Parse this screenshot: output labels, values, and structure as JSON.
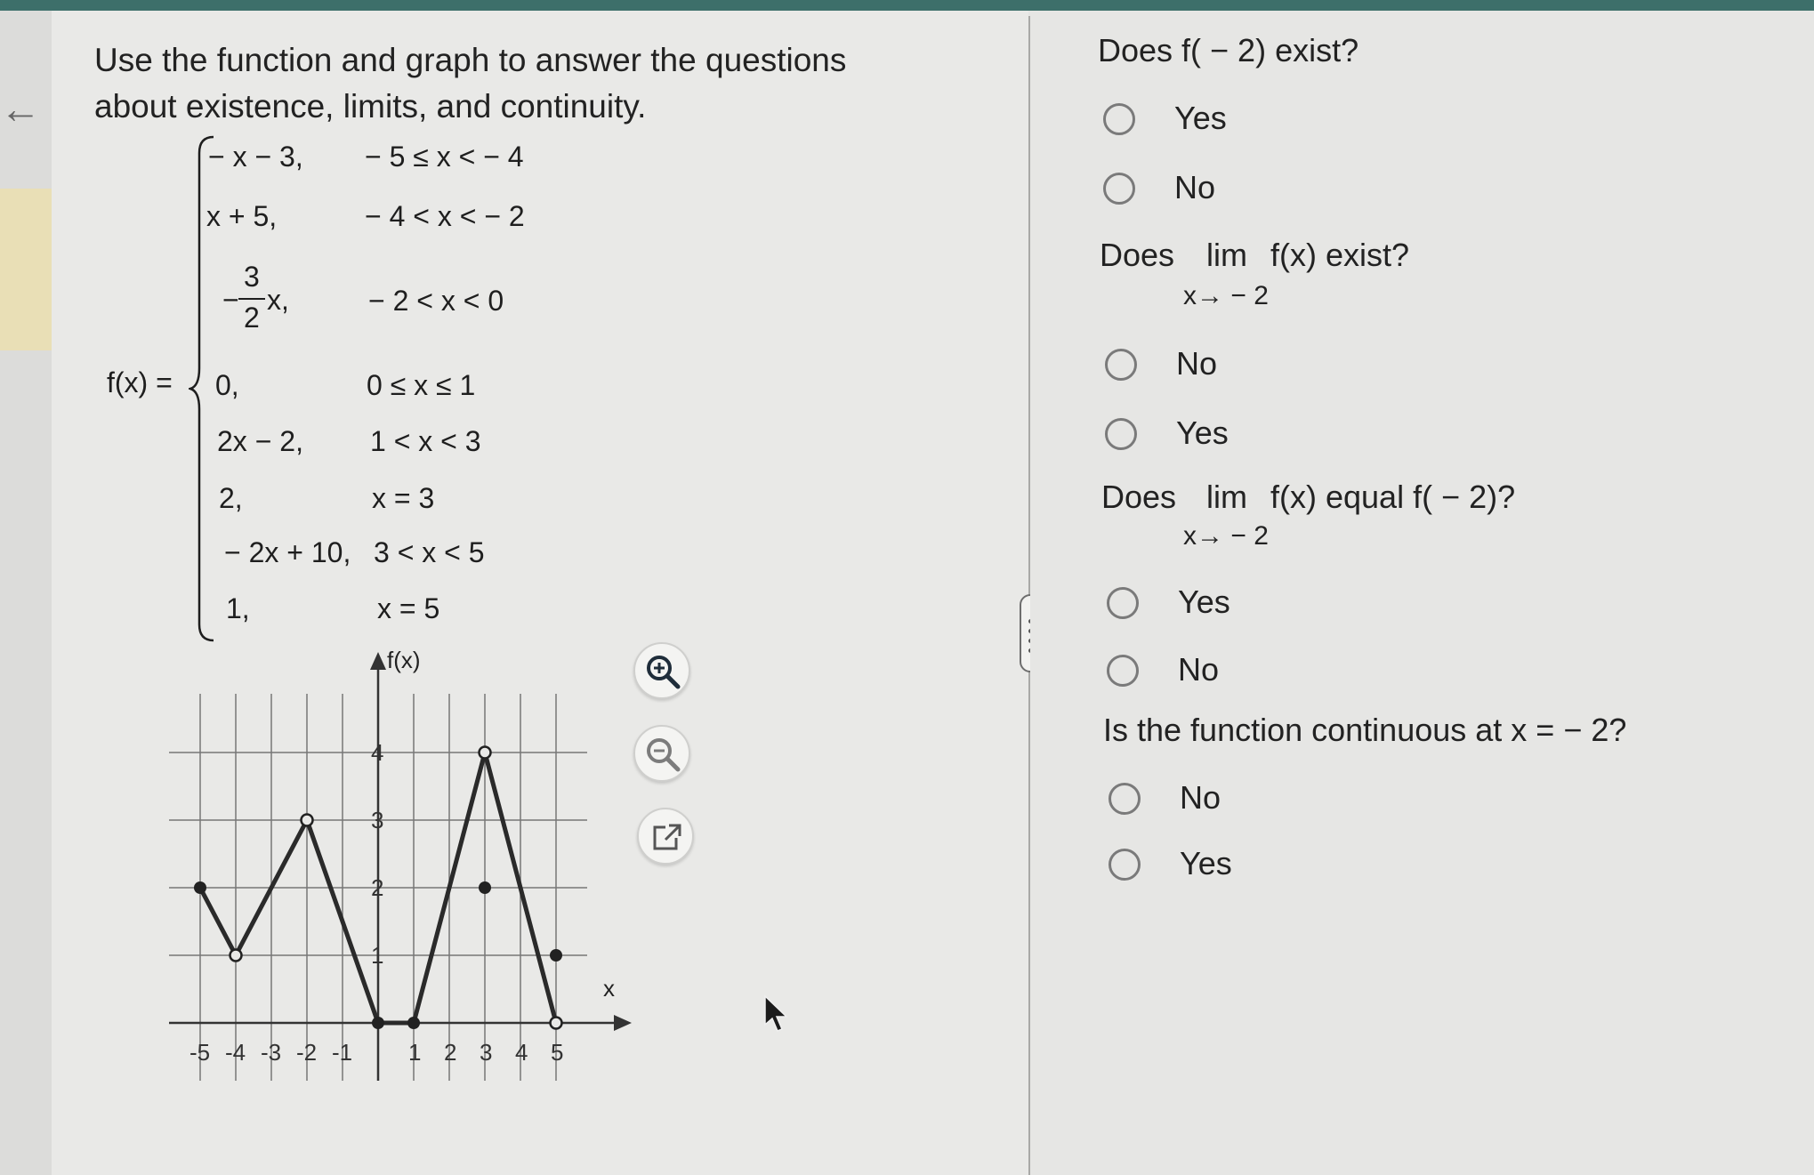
{
  "instructions": "Use the function and graph to answer the questions about existence, limits, and continuity.",
  "function": {
    "label": "f(x) =",
    "cases": [
      {
        "expr": "− x − 3,",
        "cond": "− 5 ≤ x < − 4"
      },
      {
        "expr": "x + 5,",
        "cond": "− 4 < x < − 2"
      },
      {
        "expr": "x,",
        "cond": "− 2 < x < 0"
      },
      {
        "expr": "0,",
        "cond": "0 ≤ x ≤ 1"
      },
      {
        "expr": "2x − 2,",
        "cond": "1 < x < 3"
      },
      {
        "expr": "2,",
        "cond": "x = 3"
      },
      {
        "expr": "− 2x + 10,",
        "cond": "3 < x < 5"
      },
      {
        "expr": "1,",
        "cond": "x = 5"
      }
    ],
    "fraction": {
      "sign": "−",
      "numerator": "3",
      "denominator": "2"
    }
  },
  "graph": {
    "y_axis_label": "f(x)",
    "x_axis_label": "x",
    "x_ticks": [
      "-5",
      "-4",
      "-3",
      "-2",
      "-1",
      "1",
      "2",
      "3",
      "4",
      "5"
    ],
    "y_ticks": [
      "1",
      "2",
      "3",
      "4"
    ],
    "x_range": [
      -5,
      5
    ],
    "y_range": [
      0,
      4
    ],
    "segments": [
      {
        "from": [
          -5,
          2
        ],
        "to": [
          -4,
          1
        ]
      },
      {
        "from": [
          -4,
          1
        ],
        "to": [
          -2,
          3
        ]
      },
      {
        "from": [
          -2,
          3
        ],
        "to": [
          0,
          0
        ]
      },
      {
        "from": [
          0,
          0
        ],
        "to": [
          1,
          0
        ]
      },
      {
        "from": [
          1,
          0
        ],
        "to": [
          3,
          4
        ]
      },
      {
        "from": [
          3,
          4
        ],
        "to": [
          5,
          0
        ]
      }
    ],
    "closed_points": [
      [
        -5,
        2
      ],
      [
        0,
        0
      ],
      [
        1,
        0
      ],
      [
        3,
        2
      ],
      [
        5,
        1
      ]
    ],
    "open_points": [
      [
        -4,
        1
      ],
      [
        -2,
        3
      ],
      [
        3,
        4
      ],
      [
        5,
        0
      ]
    ]
  },
  "tools": {
    "zoom_in": "zoom-in-icon",
    "zoom_out": "zoom-out-icon",
    "popout": "external-link-icon"
  },
  "questions": [
    {
      "text": "Does f( − 2) exist?",
      "options": [
        "Yes",
        "No"
      ]
    },
    {
      "prefix": "Does",
      "lim": "lim",
      "lim_sub": "x→ − 2",
      "suffix": "f(x) exist?",
      "options": [
        "No",
        "Yes"
      ]
    },
    {
      "prefix": "Does",
      "lim": "lim",
      "lim_sub": "x→ − 2",
      "suffix": "f(x) equal f( − 2)?",
      "options": [
        "Yes",
        "No"
      ]
    },
    {
      "text": "Is the function continuous at x = − 2?",
      "options": [
        "No",
        "Yes"
      ]
    }
  ],
  "colors": {
    "accent_bar": "#3d6f6a",
    "radio_border": "#7a7a7a",
    "graph_line": "#2a2a2a"
  }
}
